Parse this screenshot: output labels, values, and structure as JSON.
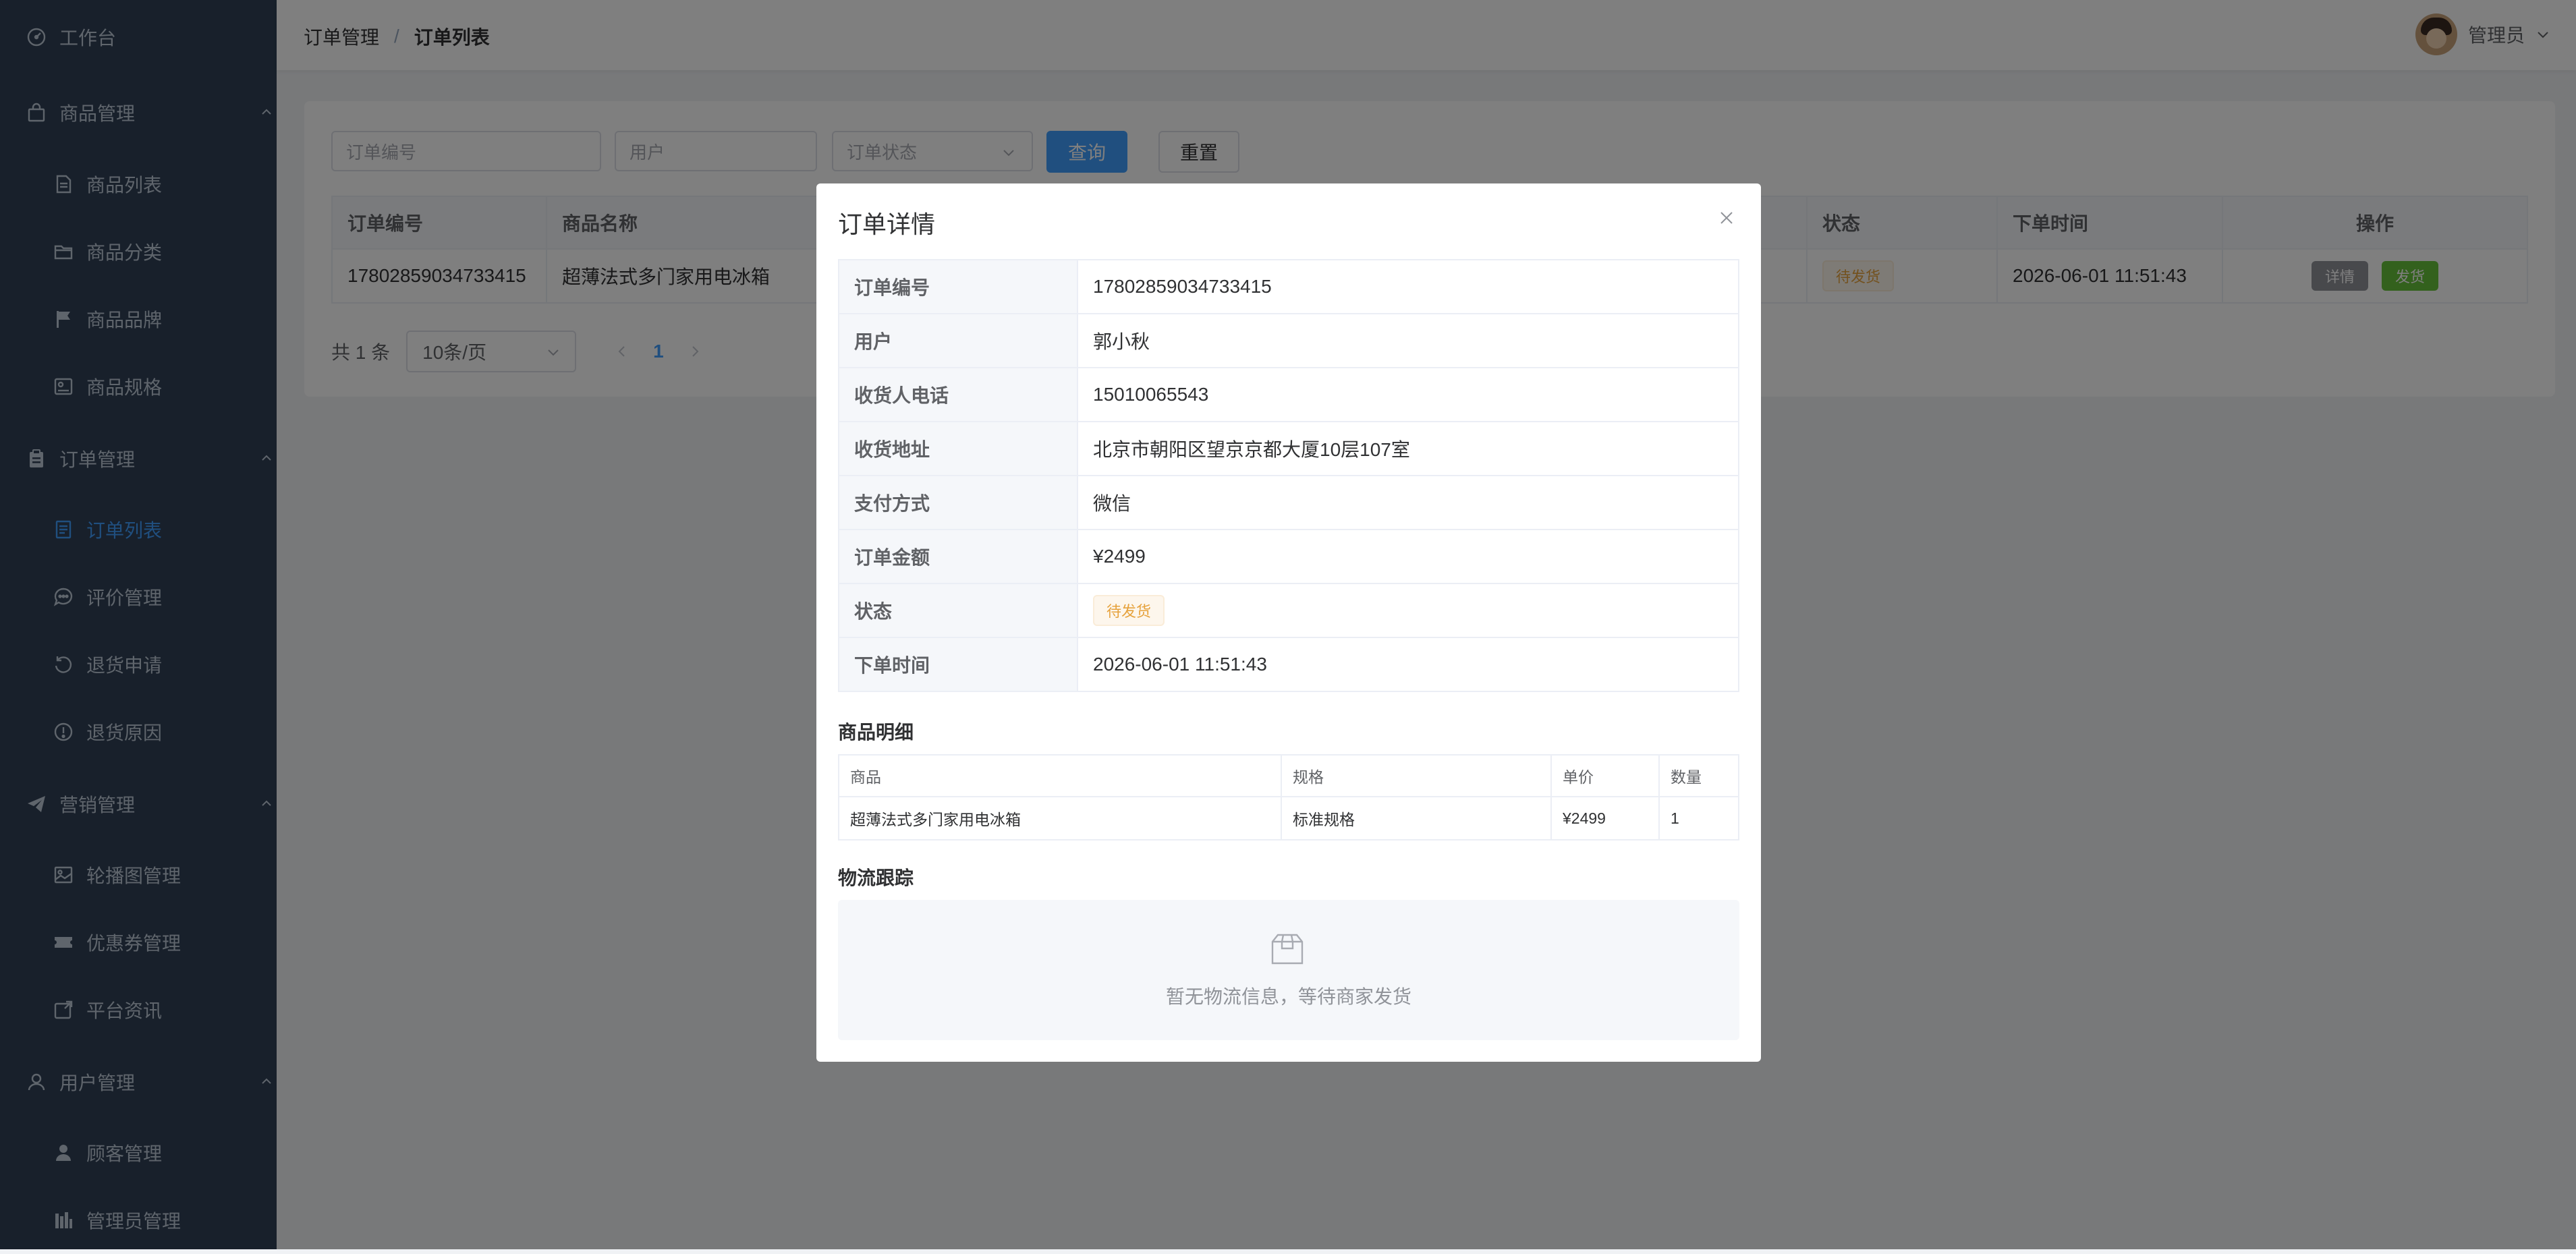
{
  "sidebar": {
    "items": [
      {
        "label": "工作台",
        "icon": "dashboard-icon"
      },
      {
        "label": "商品管理",
        "icon": "shopping-bag-icon"
      },
      {
        "label": "商品列表",
        "icon": "document-icon"
      },
      {
        "label": "商品分类",
        "icon": "folder-icon"
      },
      {
        "label": "商品品牌",
        "icon": "flag-icon"
      },
      {
        "label": "商品规格",
        "icon": "postcard-icon"
      },
      {
        "label": "订单管理",
        "icon": "clipboard-icon"
      },
      {
        "label": "订单列表",
        "icon": "list-document-icon"
      },
      {
        "label": "评价管理",
        "icon": "chat-icon"
      },
      {
        "label": "退货申请",
        "icon": "refresh-icon"
      },
      {
        "label": "退货原因",
        "icon": "warning-circle-icon"
      },
      {
        "label": "营销管理",
        "icon": "promotion-icon"
      },
      {
        "label": "轮播图管理",
        "icon": "picture-icon"
      },
      {
        "label": "优惠券管理",
        "icon": "ticket-icon"
      },
      {
        "label": "平台资讯",
        "icon": "news-icon"
      },
      {
        "label": "用户管理",
        "icon": "user-icon"
      },
      {
        "label": "顾客管理",
        "icon": "user-filled-icon"
      },
      {
        "label": "管理员管理",
        "icon": "admin-icon"
      }
    ],
    "active": "订单列表"
  },
  "header": {
    "breadcrumb": [
      "订单管理",
      "订单列表"
    ],
    "breadcrumb_sep": "/",
    "user_name": "管理员"
  },
  "filters": {
    "order_no_placeholder": "订单编号",
    "user_placeholder": "用户",
    "status_placeholder": "订单状态",
    "search_label": "查询",
    "reset_label": "重置"
  },
  "order_table": {
    "headers": [
      "订单编号",
      "商品名称",
      "",
      "",
      "",
      "",
      "",
      "状态",
      "下单时间",
      "操作"
    ],
    "rows": [
      {
        "order_no": "17802859034733415",
        "product": "超薄法式多门家用电冰箱",
        "status": "待发货",
        "time": "2026-06-01 11:51:43",
        "detail_label": "详情",
        "ship_label": "发货"
      }
    ]
  },
  "pagination": {
    "total_text": "共 1 条",
    "page_size": "10条/页",
    "current_page": "1"
  },
  "modal": {
    "title": "订单详情",
    "fields": [
      {
        "label": "订单编号",
        "value": "17802859034733415"
      },
      {
        "label": "用户",
        "value": "郭小秋"
      },
      {
        "label": "收货人电话",
        "value": "15010065543"
      },
      {
        "label": "收货地址",
        "value": "北京市朝阳区望京京都大厦10层107室"
      },
      {
        "label": "支付方式",
        "value": "微信"
      },
      {
        "label": "订单金额",
        "value": "¥2499"
      },
      {
        "label": "状态",
        "value": "待发货"
      },
      {
        "label": "下单时间",
        "value": "2026-06-01 11:51:43"
      }
    ],
    "goods_title": "商品明细",
    "goods_headers": [
      "商品",
      "规格",
      "单价",
      "数量"
    ],
    "goods_rows": [
      [
        "超薄法式多门家用电冰箱",
        "标准规格",
        "¥2499",
        "1"
      ]
    ],
    "logistics_title": "物流跟踪",
    "logistics_empty": "暂无物流信息，等待商家发货"
  },
  "colors": {
    "sidebar_bg": "#304156",
    "primary": "#409eff",
    "warning": "#e6a23c",
    "success": "#67c23a",
    "info": "#909399"
  }
}
